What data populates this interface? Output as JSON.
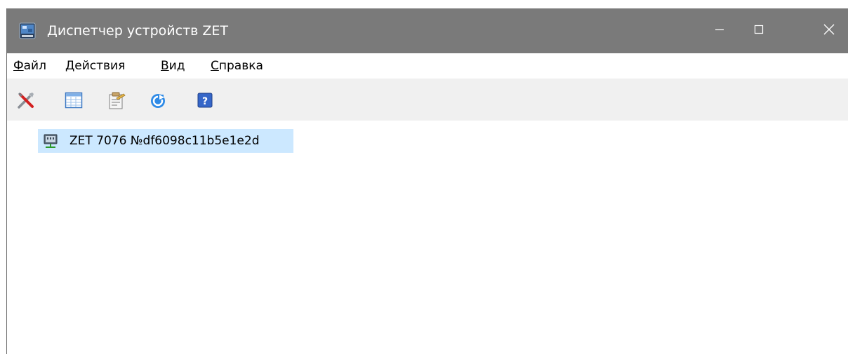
{
  "window": {
    "title": "Диспетчер устройств ZET",
    "icons": {
      "app": "device-manager-app-icon",
      "minimize": "minimize-icon",
      "maximize": "maximize-icon",
      "close": "close-icon"
    }
  },
  "menubar": {
    "items": [
      {
        "key": "Ф",
        "rest": "айл"
      },
      {
        "key": "Д",
        "rest": "ействия"
      },
      {
        "key": "В",
        "rest": "ид"
      },
      {
        "key": "С",
        "rest": "правка"
      }
    ]
  },
  "toolbar": {
    "buttons": [
      {
        "icon": "tools-icon"
      },
      {
        "icon": "table-view-icon"
      },
      {
        "icon": "properties-icon"
      },
      {
        "icon": "refresh-icon"
      },
      {
        "icon": "help-icon"
      }
    ]
  },
  "tree": {
    "items": [
      {
        "label": "ZET 7076 №df6098c11b5e1e2d",
        "icon": "network-device-icon",
        "selected": true
      }
    ]
  },
  "colors": {
    "titlebar": "#7a7a7a",
    "toolbar": "#f0f0f0",
    "selection": "#cce8ff"
  }
}
